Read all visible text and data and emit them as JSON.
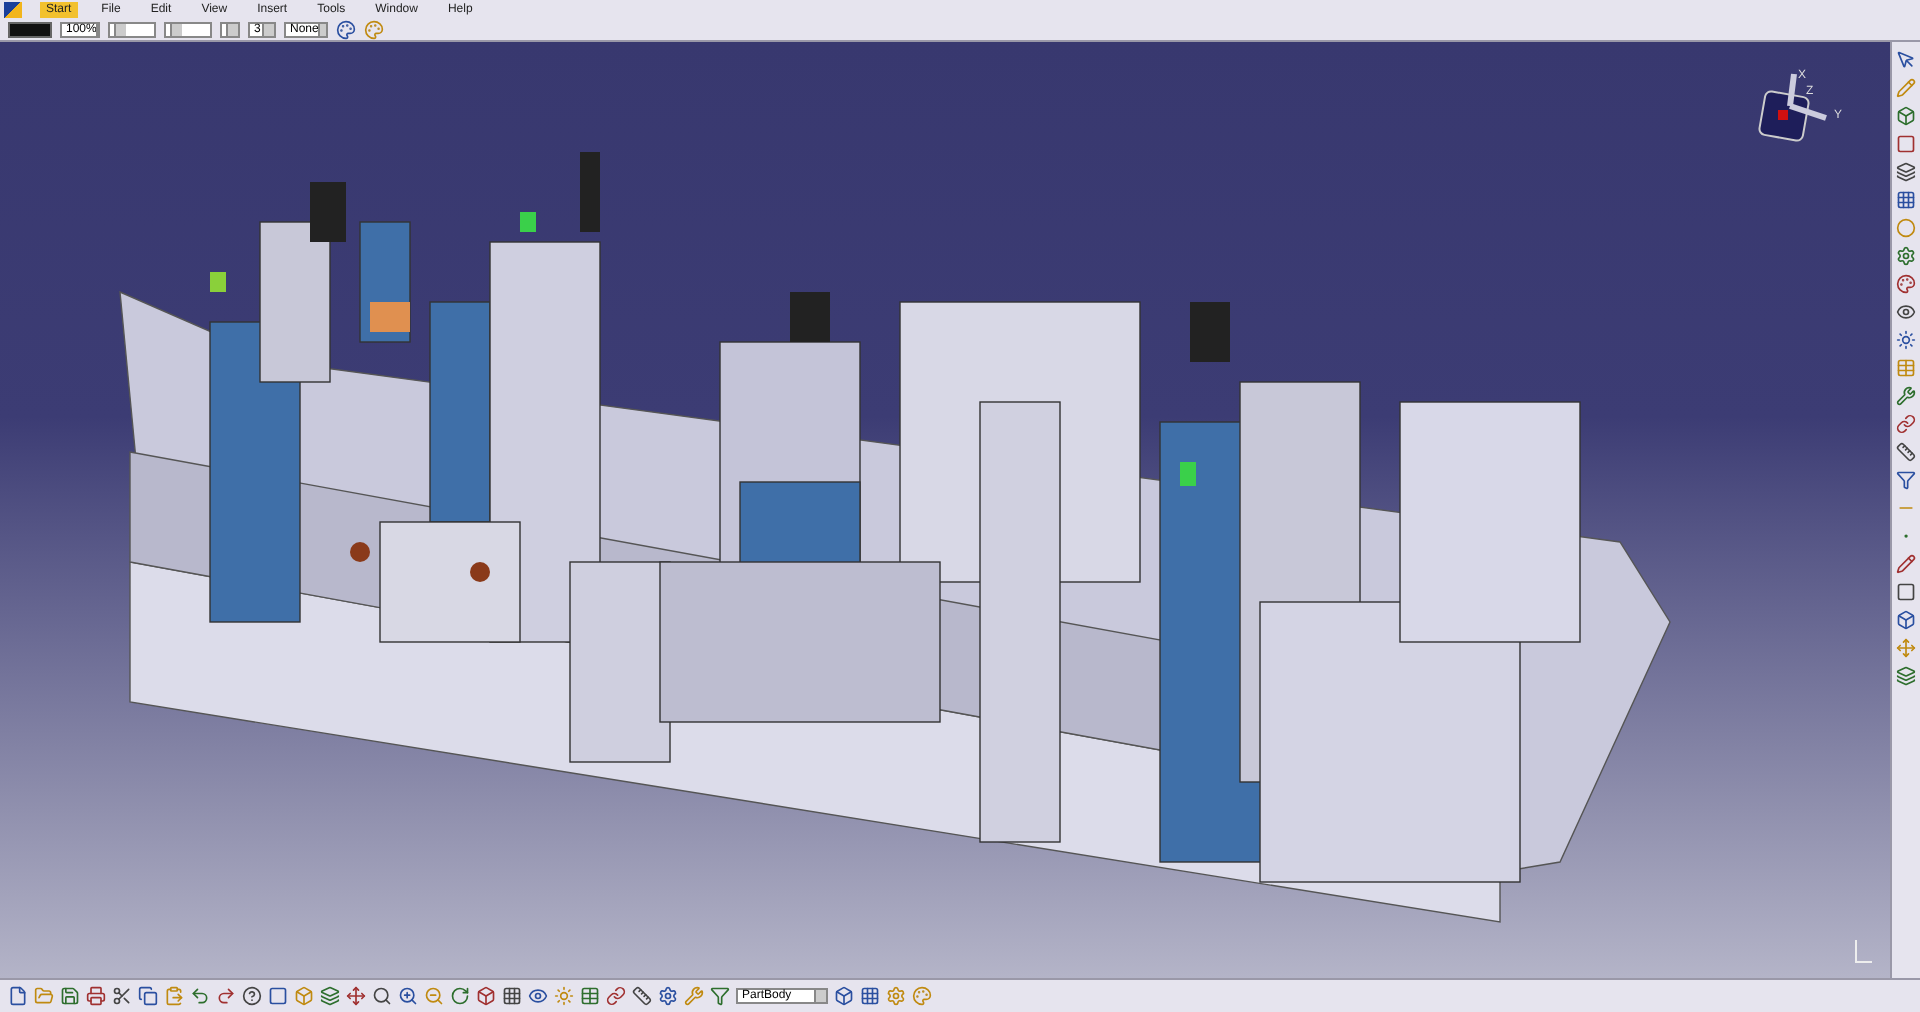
{
  "menu": [
    {
      "label": "Start",
      "selected": true
    },
    {
      "label": "File",
      "selected": false
    },
    {
      "label": "Edit",
      "selected": false
    },
    {
      "label": "View",
      "selected": false
    },
    {
      "label": "Insert",
      "selected": false
    },
    {
      "label": "Tools",
      "selected": false
    },
    {
      "label": "Window",
      "selected": false
    },
    {
      "label": "Help",
      "selected": false
    }
  ],
  "format_toolbar": {
    "zoom": "100%",
    "thickness": "3",
    "layer": "None"
  },
  "compass": {
    "x": "X",
    "y": "Y",
    "z": "Z"
  },
  "bottom_toolbar": {
    "body": "PartBody"
  }
}
